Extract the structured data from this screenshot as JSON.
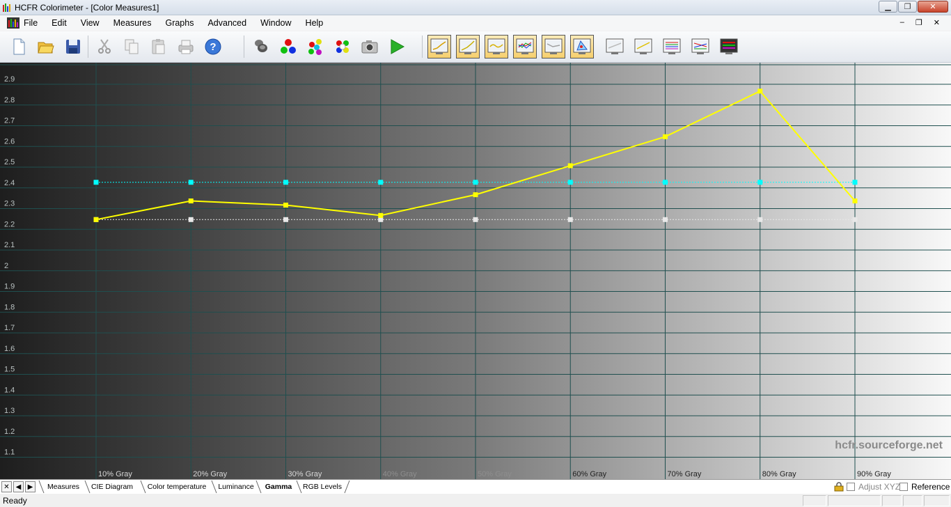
{
  "window": {
    "title": "HCFR Colorimeter - [Color Measures1]",
    "controls": [
      "minimize",
      "maximize",
      "close"
    ]
  },
  "menubar": {
    "items": [
      "File",
      "Edit",
      "View",
      "Measures",
      "Graphs",
      "Advanced",
      "Window",
      "Help"
    ],
    "mdi_controls": [
      "–",
      "❐",
      "✕"
    ]
  },
  "toolbar": {
    "groups": [
      [
        "new-doc-icon",
        "open-folder-icon",
        "save-icon"
      ],
      [
        "cut-icon",
        "copy-icon",
        "paste-icon",
        "print-icon",
        "help-icon"
      ],
      [
        "sensor-icon",
        "rgb-balls-icon",
        "color-spheres-icon",
        "color-cluster-icon",
        "camera-icon",
        "play-icon"
      ],
      [
        "graph-luminance-icon",
        "graph-gamma-icon",
        "graph-curve-icon",
        "graph-rgb-levels-icon",
        "graph-color-temp-icon",
        "graph-cie-icon"
      ],
      [
        "graph-white-icon",
        "graph-yellow-icon",
        "graph-rainbow-icon",
        "graph-multi-icon",
        "graph-spectrum-icon"
      ]
    ],
    "pressed": [
      "graph-luminance-icon",
      "graph-gamma-icon",
      "graph-curve-icon",
      "graph-rgb-levels-icon",
      "graph-color-temp-icon",
      "graph-cie-icon"
    ]
  },
  "chart_data": {
    "type": "line",
    "title": "",
    "xlabel": "",
    "ylabel": "",
    "categories": [
      "10% Gray",
      "20% Gray",
      "30% Gray",
      "40% Gray",
      "50% Gray",
      "60% Gray",
      "70% Gray",
      "80% Gray",
      "90% Gray"
    ],
    "ylim": [
      1.0,
      3.0
    ],
    "yticks": [
      "2.9",
      "2.8",
      "2.7",
      "2.6",
      "2.5",
      "2.4",
      "2.3",
      "2.2",
      "2.1",
      "2",
      "1.9",
      "1.8",
      "1.7",
      "1.6",
      "1.5",
      "1.4",
      "1.3",
      "1.2",
      "1.1"
    ],
    "series": [
      {
        "color": "#ffff00",
        "style": "solid",
        "values": [
          2.22,
          2.31,
          2.29,
          2.24,
          2.34,
          2.48,
          2.62,
          2.84,
          2.31
        ]
      },
      {
        "color": "#00ffff",
        "style": "dotted",
        "values": [
          2.4,
          2.4,
          2.4,
          2.4,
          2.4,
          2.4,
          2.4,
          2.4,
          2.4
        ]
      },
      {
        "color": "#e8e8e8",
        "style": "dotted",
        "values": [
          2.22,
          2.22,
          2.22,
          2.22,
          2.22,
          2.22,
          2.22,
          2.22,
          2.22
        ]
      }
    ],
    "grid": true,
    "background": "gray gradient dark to light",
    "watermark": "hcfr.sourceforge.net"
  },
  "tabs": {
    "nav": [
      "✕",
      "◀",
      "▶"
    ],
    "items": [
      "Measures",
      "CIE Diagram",
      "Color temperature",
      "Luminance",
      "Gamma",
      "RGB Levels"
    ],
    "active": "Gamma",
    "options": [
      {
        "label": "Adjust XYZ",
        "checked": false,
        "enabled": false
      },
      {
        "label": "Reference",
        "checked": false,
        "enabled": true
      }
    ]
  },
  "status": {
    "text": "Ready"
  },
  "colors": {
    "gamma_line": "#ffff00",
    "reference_line": "#00ffff",
    "target_line": "#e8e8e8",
    "grid": "#2a5a5a"
  }
}
